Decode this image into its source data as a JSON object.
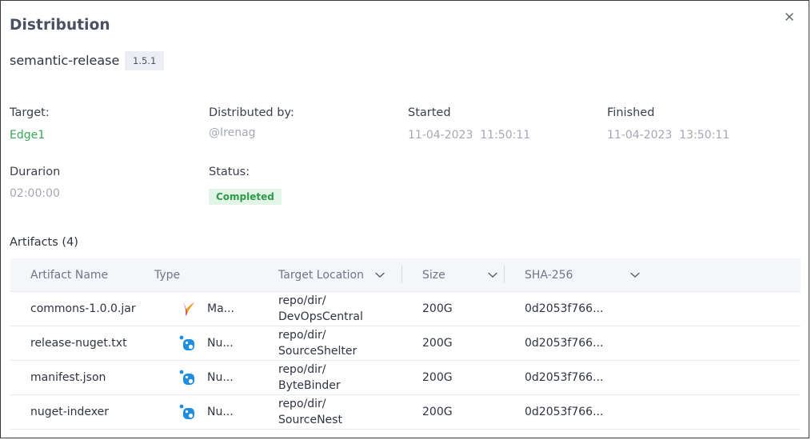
{
  "modal": {
    "title": "Distribution",
    "package_name": "semantic-release",
    "version": "1.5.1"
  },
  "details": {
    "target_label": "Target:",
    "target_value": "Edge1",
    "distributed_by_label": "Distributed by:",
    "distributed_by_value": "@Irenag",
    "started_label": "Started",
    "started_value": "11-04-2023  11:50:11",
    "finished_label": "Finished",
    "finished_value": "11-04-2023  13:50:11",
    "duration_label": "Durarion",
    "duration_value": "02:00:00",
    "status_label": "Status:",
    "status_value": "Completed"
  },
  "artifacts": {
    "title": "Artifacts (4)",
    "columns": {
      "name": "Artifact Name",
      "type": "Type",
      "location": "Target Location",
      "size": "Size",
      "sha": "SHA-256"
    },
    "rows": [
      {
        "name": "commons-1.0.0.jar",
        "type": "Ma...",
        "icon": "maven-feather-icon",
        "location_1": "repo/dir/",
        "location_2": "DevOpsCentral",
        "size": "200G",
        "sha": "0d2053f766..."
      },
      {
        "name": "release-nuget.txt",
        "type": "Nu...",
        "icon": "nuget-icon",
        "location_1": "repo/dir/",
        "location_2": "SourceShelter",
        "size": "200G",
        "sha": "0d2053f766..."
      },
      {
        "name": "manifest.json",
        "type": "Nu...",
        "icon": "nuget-icon",
        "location_1": "repo/dir/",
        "location_2": "ByteBinder",
        "size": "200G",
        "sha": "0d2053f766..."
      },
      {
        "name": "nuget-indexer",
        "type": "Nu...",
        "icon": "nuget-icon",
        "location_1": "repo/dir/",
        "location_2": "SourceNest",
        "size": "200G",
        "sha": "0d2053f766..."
      }
    ]
  },
  "colors": {
    "accent_green": "#3aa757",
    "badge_bg": "#e3f5e7",
    "nuget_blue": "#1f8ee0",
    "header_bg": "#f5f6f9"
  }
}
